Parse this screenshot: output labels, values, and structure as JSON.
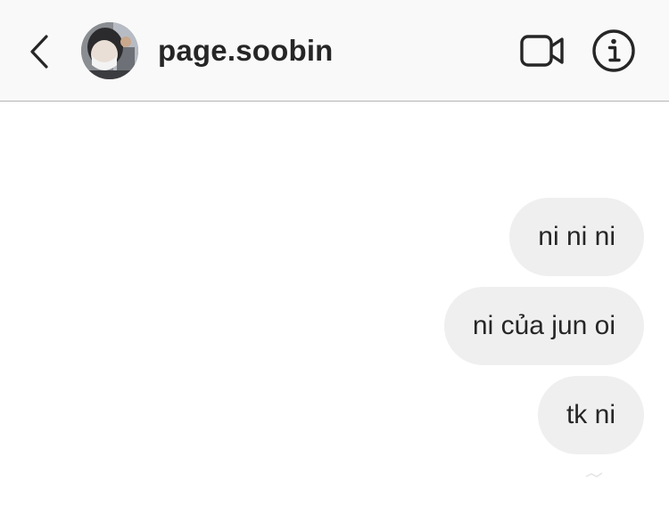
{
  "header": {
    "username": "page.soobin",
    "back_icon": "chevron-left-icon",
    "video_icon": "video-camera-icon",
    "info_icon": "info-circle-icon"
  },
  "messages": [
    {
      "text": "ni ni ni",
      "sender": "self"
    },
    {
      "text": "ni của jun oi",
      "sender": "self"
    },
    {
      "text": "tk ni",
      "sender": "self"
    }
  ],
  "colors": {
    "header_bg": "#f9f9f9",
    "bubble_bg": "#efefef",
    "text": "#262626",
    "divider": "#b5b5b5"
  }
}
